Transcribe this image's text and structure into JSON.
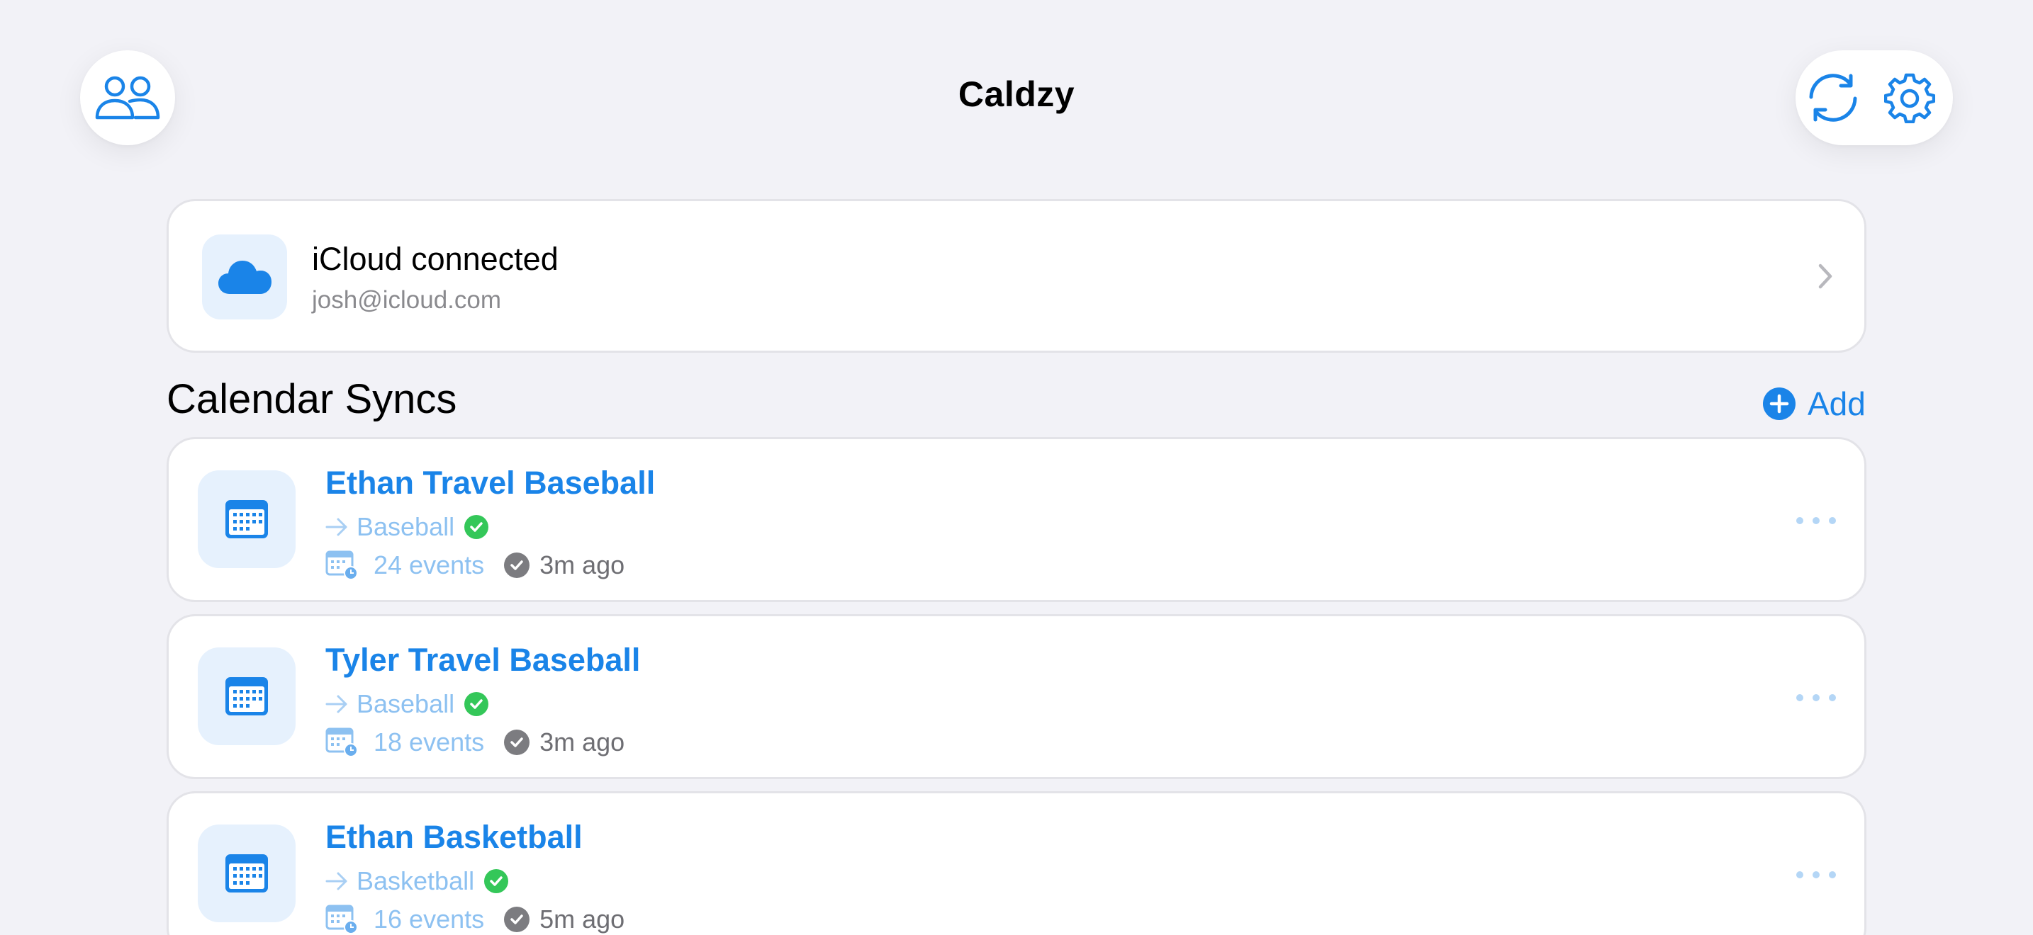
{
  "app": {
    "title": "Caldzy"
  },
  "header": {
    "left_icon": "people-icon",
    "right_icons": [
      "sync-icon",
      "gear-icon"
    ]
  },
  "account": {
    "status": "iCloud connected",
    "email": "josh@icloud.com",
    "icon": "cloud-icon"
  },
  "section": {
    "title": "Calendar Syncs",
    "add_label": "Add"
  },
  "syncs": [
    {
      "name": "Ethan Travel Baseball",
      "target": "Baseball",
      "events": "24 events",
      "last_sync": "3m ago"
    },
    {
      "name": "Tyler Travel Baseball",
      "target": "Baseball",
      "events": "18 events",
      "last_sync": "3m ago"
    },
    {
      "name": "Ethan Basketball",
      "target": "Basketball",
      "events": "16 events",
      "last_sync": "5m ago"
    }
  ],
  "colors": {
    "accent": "#1a84e8",
    "accent_light": "#8dc1f1",
    "success": "#34c759",
    "background": "#f2f2f7"
  }
}
